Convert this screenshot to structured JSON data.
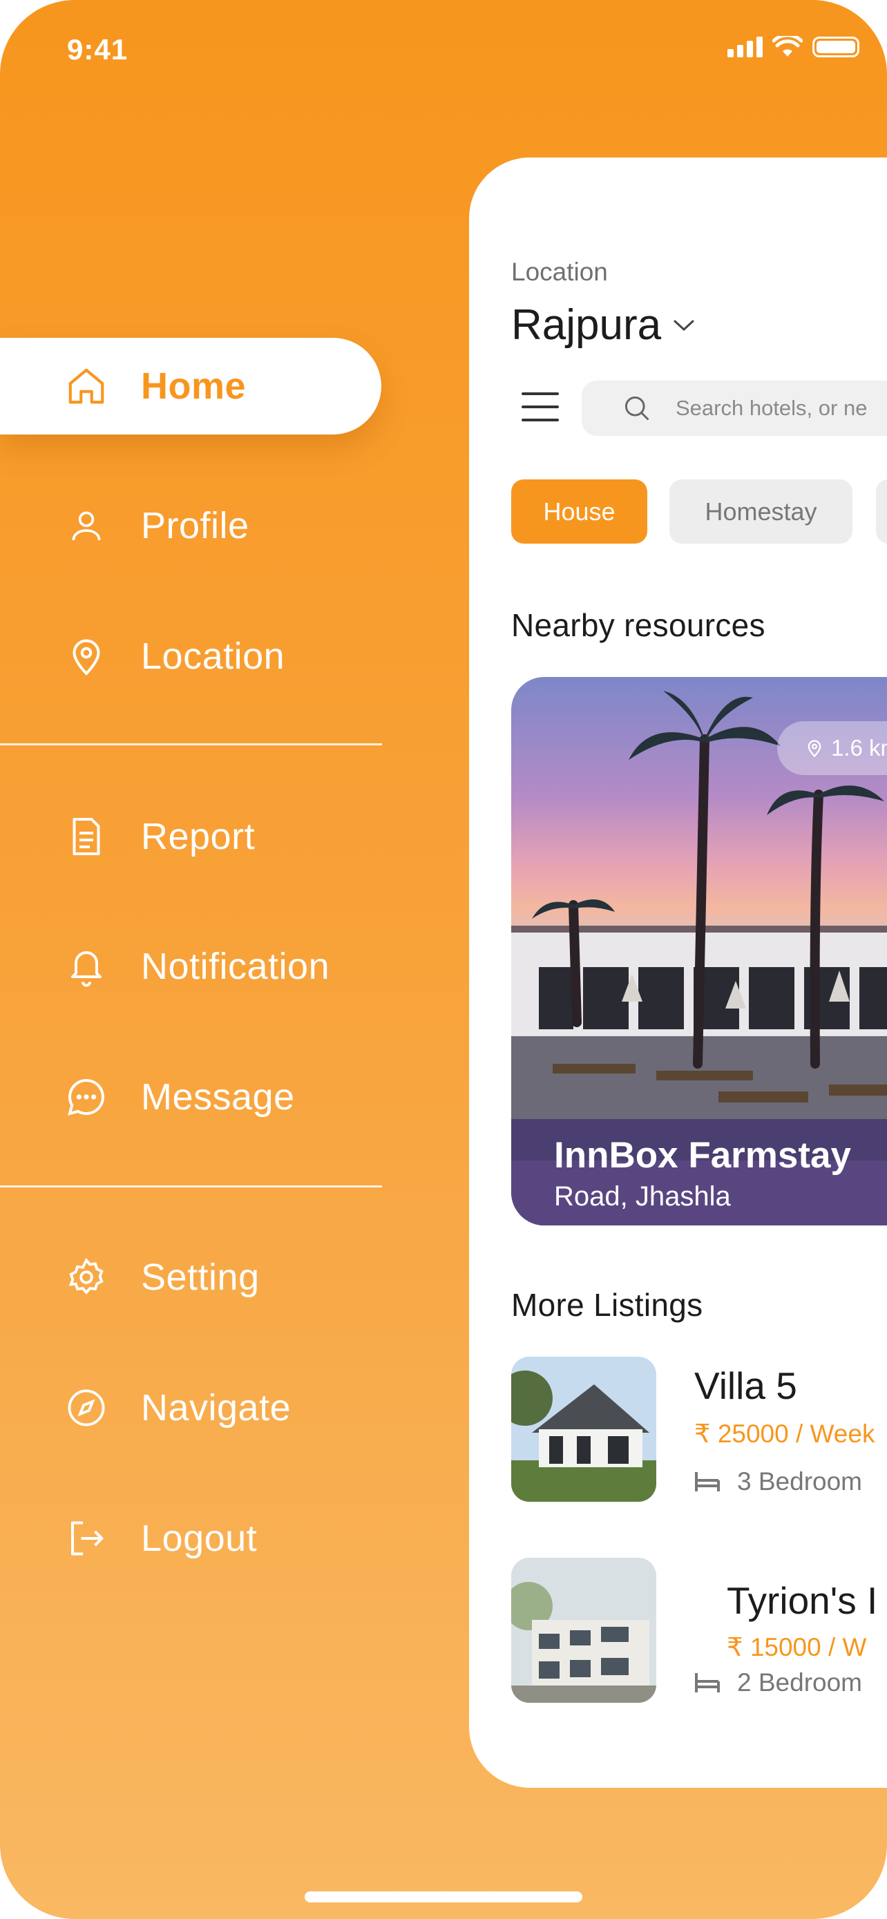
{
  "status": {
    "time": "9:41"
  },
  "colors": {
    "accent": "#F7961E",
    "text": "#1C1C1C",
    "muted": "#777777"
  },
  "menu": {
    "items": [
      {
        "label": "Home",
        "icon": "home-icon",
        "active": true
      },
      {
        "label": "Profile",
        "icon": "user-icon"
      },
      {
        "label": "Location",
        "icon": "location-pin-icon"
      },
      {
        "label": "Report",
        "icon": "document-icon"
      },
      {
        "label": "Notification",
        "icon": "bell-icon"
      },
      {
        "label": "Message",
        "icon": "chat-bubble-icon"
      },
      {
        "label": "Setting",
        "icon": "gear-icon"
      },
      {
        "label": "Navigate",
        "icon": "compass-icon"
      },
      {
        "label": "Logout",
        "icon": "logout-icon"
      }
    ]
  },
  "location": {
    "label": "Location",
    "city": "Rajpura"
  },
  "search": {
    "placeholder": "Search hotels, or ne"
  },
  "categories": [
    {
      "label": "House",
      "selected": true
    },
    {
      "label": "Homestay",
      "selected": false
    }
  ],
  "nearby": {
    "title": "Nearby resources",
    "card": {
      "distance": "1.6 kn",
      "name": "InnBox Farmstay",
      "address": "Road, Jhashla"
    }
  },
  "more": {
    "title": "More Listings",
    "items": [
      {
        "name": "Villa 5",
        "price": "₹ 25000 / Week",
        "bedrooms": "3 Bedroom"
      },
      {
        "name": "Tyrion's I",
        "price": "₹ 15000 / W",
        "bedrooms": "2 Bedroom"
      }
    ]
  }
}
